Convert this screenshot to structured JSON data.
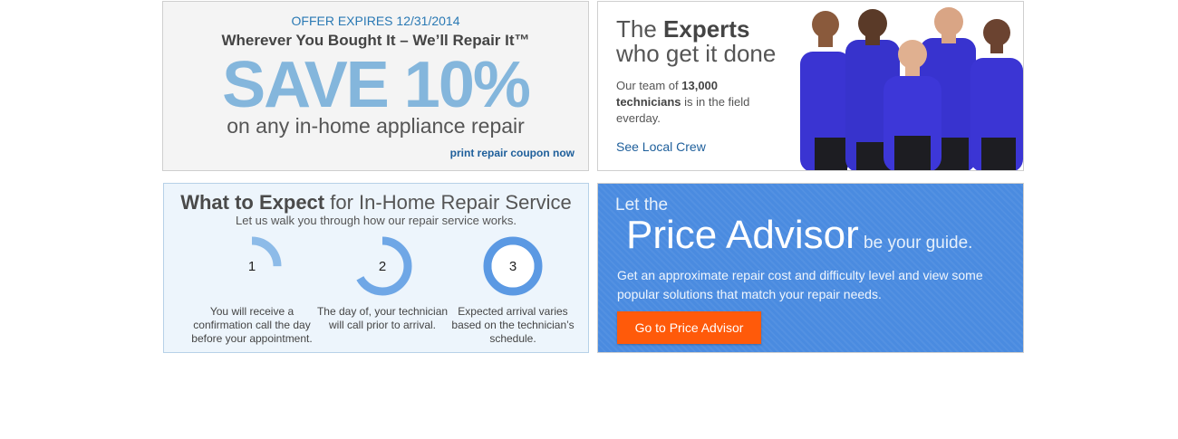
{
  "coupon": {
    "expires": "OFFER EXPIRES 12/31/2014",
    "tagline": "Wherever You Bought It – We’ll Repair It™",
    "headline": "SAVE 10%",
    "subline": "on any in-home appliance repair",
    "print_link": "print repair coupon now"
  },
  "experts": {
    "title_prefix": "The ",
    "title_bold": "Experts",
    "title_line2": "who get it done",
    "desc_pre": "Our team of ",
    "desc_count": "13,000",
    "desc_bold2": "technicians",
    "desc_post": " is in the field everday.",
    "link": "See Local Crew"
  },
  "expect": {
    "title_bold": "What to Expect",
    "title_rest": " for In-Home Repair Service",
    "subtitle": "Let us walk you through how our repair service works.",
    "steps": [
      {
        "number": "1",
        "progress": 0.25,
        "caption": "You will receive a confirmation call the day before your appointment."
      },
      {
        "number": "2",
        "progress": 0.67,
        "caption": "The day of, your technician will call prior to arrival."
      },
      {
        "number": "3",
        "progress": 1.0,
        "caption": "Expected arrival varies based on the technician’s schedule."
      }
    ]
  },
  "advisor": {
    "let_the": "Let the",
    "title": "Price Advisor",
    "title_suffix": " be your guide.",
    "description": "Get an approximate repair cost and difficulty level and view some popular solutions that match your repair needs.",
    "button": "Go to Price Advisor"
  },
  "colors": {
    "accent_blue": "#84b6dc",
    "link_blue": "#1e5f9b",
    "advisor_bg": "#4a8be0",
    "button_orange": "#ff5a0a",
    "ring_blue": "#5b99e3",
    "uniform_blue": "#3a34d2"
  }
}
